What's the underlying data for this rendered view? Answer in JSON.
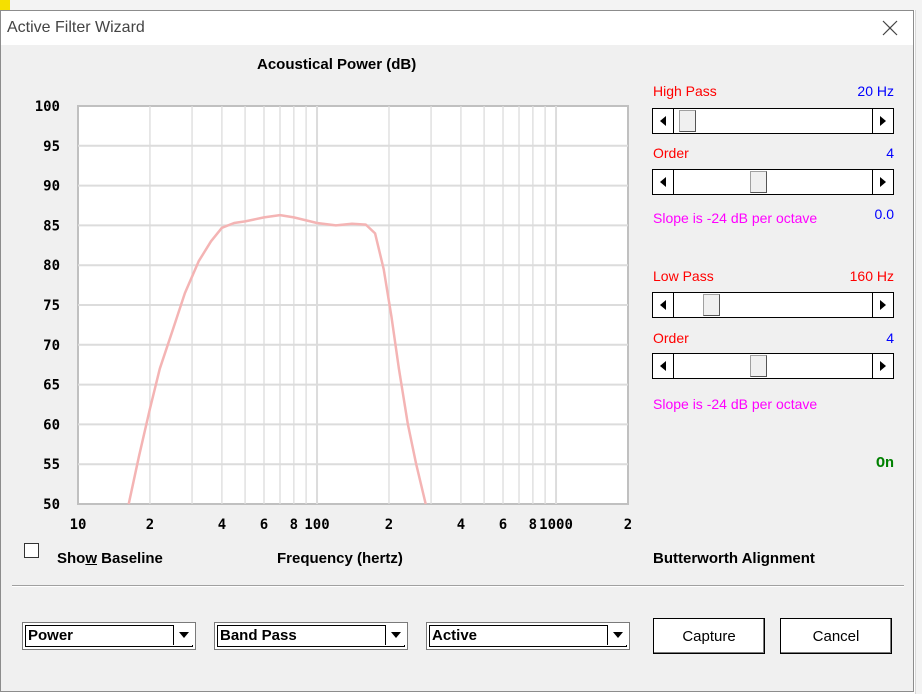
{
  "window": {
    "title": "Active Filter Wizard"
  },
  "chart_data": {
    "type": "line",
    "title": "Acoustical Power (dB)",
    "xlabel": "Frequency (hertz)",
    "ylabel": "",
    "x_scale": "log",
    "xlim": [
      10,
      2000
    ],
    "ylim": [
      50,
      100
    ],
    "y_ticks": [
      100,
      95,
      90,
      85,
      80,
      75,
      70,
      65,
      60,
      55,
      50
    ],
    "x_tick_labels": [
      {
        "value": 10,
        "label": "10"
      },
      {
        "value": 20,
        "label": "2"
      },
      {
        "value": 40,
        "label": "4"
      },
      {
        "value": 60,
        "label": "6"
      },
      {
        "value": 80,
        "label": "8"
      },
      {
        "value": 100,
        "label": "100"
      },
      {
        "value": 200,
        "label": "2"
      },
      {
        "value": 400,
        "label": "4"
      },
      {
        "value": 600,
        "label": "6"
      },
      {
        "value": 800,
        "label": "8"
      },
      {
        "value": 1000,
        "label": "1000"
      },
      {
        "value": 2000,
        "label": "2"
      }
    ],
    "grid": true,
    "series": [
      {
        "color": "#f4b4b4",
        "x": [
          16.3,
          18,
          20,
          22,
          25,
          28,
          32,
          36,
          40,
          45,
          50,
          60,
          70,
          80,
          100,
          120,
          140,
          160,
          175,
          190,
          205,
          220,
          240,
          260,
          285
        ],
        "y": [
          50,
          56,
          62,
          67,
          72,
          76.5,
          80.5,
          83,
          84.7,
          85.3,
          85.5,
          86,
          86.3,
          86,
          85.3,
          85,
          85.2,
          85.1,
          84,
          79.5,
          73.5,
          67,
          60,
          55,
          50
        ]
      }
    ]
  },
  "high_pass": {
    "label": "High Pass",
    "value": "20 Hz",
    "slider_position": 0.03,
    "order_label": "Order",
    "order_value": "4",
    "order_slider_position": 0.42,
    "slope_text": "Slope is -24 dB per octave",
    "slope_value": "0.0"
  },
  "low_pass": {
    "label": "Low Pass",
    "value": "160 Hz",
    "slider_position": 0.16,
    "order_label": "Order",
    "order_value": "4",
    "order_slider_position": 0.42,
    "slope_text": "Slope is -24 dB per octave"
  },
  "status": {
    "on": "On",
    "alignment": "Butterworth Alignment"
  },
  "show_baseline": {
    "label_pre": "Sho",
    "label_accel": "w",
    "label_post": " Baseline",
    "checked": false
  },
  "dropdowns": {
    "mode": "Power",
    "filter_type": "Band Pass",
    "circuit": "Active"
  },
  "buttons": {
    "capture": "Capture",
    "cancel": "Cancel"
  },
  "colors": {
    "label_red": "#ff0000",
    "value_blue": "#0000ff",
    "slope_magenta": "#ff00ff",
    "on_green": "#008000",
    "curve": "#f4b4b4"
  }
}
